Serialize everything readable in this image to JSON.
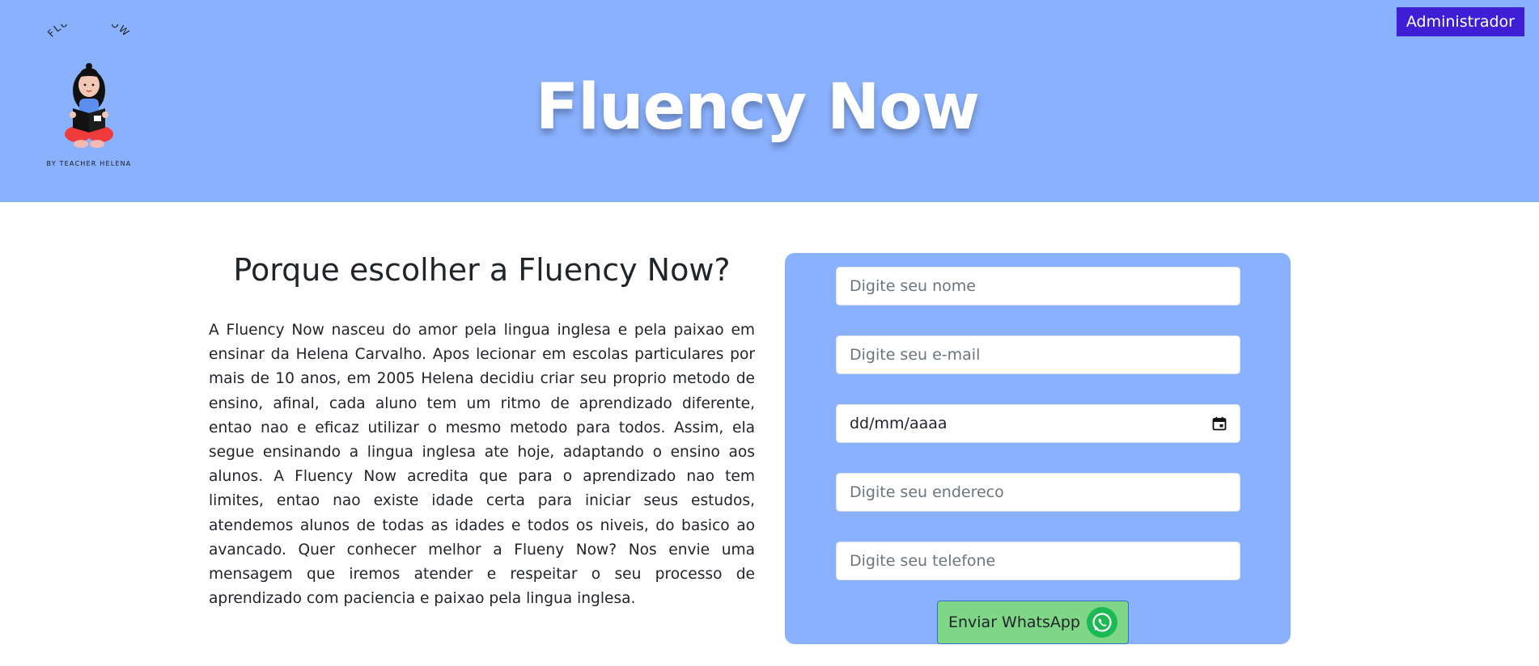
{
  "header": {
    "logo_arc_text": "FLUENCYNOW",
    "logo_subtext": "BY TEACHER HELENA",
    "title": "Fluency Now",
    "admin_label": "Administrador",
    "background": "#8ab1fe",
    "admin_color": "#3f1fd6"
  },
  "about": {
    "heading": "Porque escolher a Fluency Now?",
    "body": "A Fluency Now nasceu do amor pela lingua inglesa e pela paixao em ensinar da Helena Carvalho. Apos lecionar em escolas particulares por mais de 10 anos, em 2005 Helena decidiu criar seu proprio metodo de ensino, afinal, cada aluno tem um ritmo de aprendizado diferente, entao nao e eficaz utilizar o mesmo metodo para todos. Assim, ela segue ensinando a lingua inglesa ate hoje, adaptando o ensino aos alunos. A Fluency Now acredita que para o aprendizado nao tem limites, entao nao existe idade certa para iniciar seus estudos, atendemos alunos de todas as idades e todos os niveis, do basico ao avancado. Quer conhecer melhor a Flueny Now? Nos envie uma mensagem que iremos atender e respeitar o seu processo de aprendizado com paciencia e paixao pela lingua inglesa."
  },
  "form": {
    "name_placeholder": "Digite seu nome",
    "email_placeholder": "Digite seu e-mail",
    "date_placeholder": "dd/mm/aaaa",
    "address_placeholder": "Digite seu endereco",
    "phone_placeholder": "Digite seu telefone",
    "submit_label": "Enviar WhatsApp",
    "submit_icon": "whatsapp-icon",
    "submit_color": "#7fd687"
  }
}
